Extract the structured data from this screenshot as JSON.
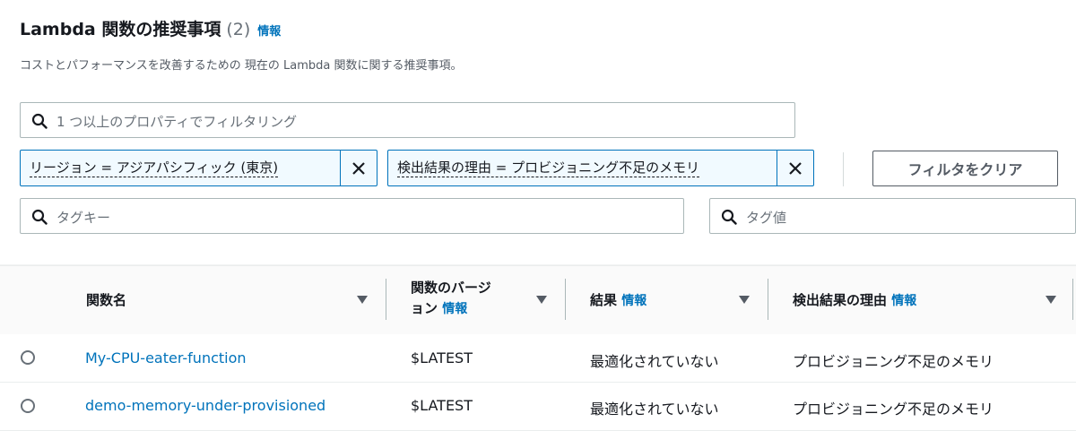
{
  "header": {
    "title": "Lambda 関数の推奨事項",
    "count": "(2)",
    "info_link": "情報",
    "description": "コストとパフォーマンスを改善するための 現在の Lambda 関数に関する推奨事項。"
  },
  "filter": {
    "search_placeholder": "1 つ以上のプロパティでフィルタリング",
    "tokens": [
      {
        "label": "リージョン = アジアパシフィック (東京)"
      },
      {
        "label": "検出結果の理由 = プロビジョニング不足のメモリ"
      }
    ],
    "clear_label": "フィルタをクリア",
    "tag_key_placeholder": "タグキー",
    "tag_value_placeholder": "タグ値"
  },
  "table": {
    "columns": [
      {
        "label": "関数名"
      },
      {
        "label_line1": "関数のバージ",
        "label_line2": "ョン",
        "info": "情報"
      },
      {
        "label": "結果",
        "info": "情報"
      },
      {
        "label": "検出結果の理由",
        "info": "情報"
      }
    ],
    "rows": [
      {
        "name": "My-CPU-eater-function",
        "version": "$LATEST",
        "result": "最適化されていない",
        "reason": "プロビジョニング不足のメモリ"
      },
      {
        "name": "demo-memory-under-provisioned",
        "version": "$LATEST",
        "result": "最適化されていない",
        "reason": "プロビジョニング不足のメモリ"
      }
    ]
  },
  "colors": {
    "link": "#0073bb",
    "token_border": "#0073bb",
    "token_bg": "#f1faff"
  }
}
